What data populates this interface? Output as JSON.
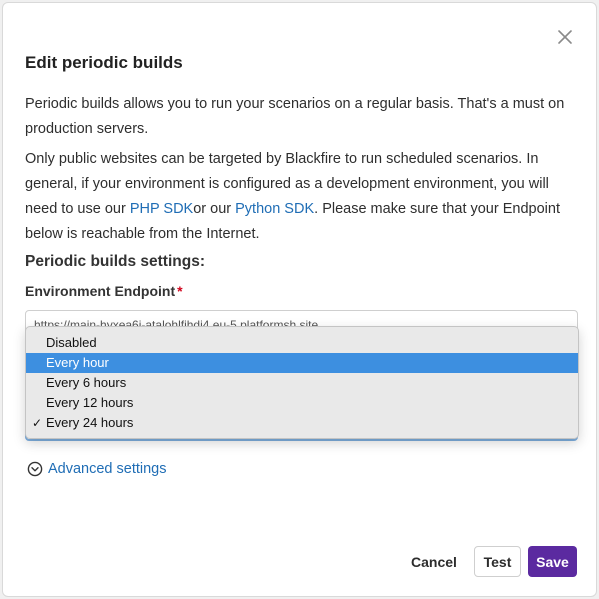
{
  "modal": {
    "title": "Edit periodic builds",
    "close_icon": "close-icon",
    "intro": "Periodic builds allows you to run your scenarios on a regular basis. That's a must on production servers.",
    "description": {
      "part1": "Only public websites can be targeted by Blackfire to run scheduled scenarios. In general, if your environment is configured as a development environment, you will need to use our ",
      "link_php": "PHP SDK",
      "part2": "or our ",
      "link_python": "Python SDK",
      "part3": ". Please make sure that your Endpoint below is reachable from the Internet."
    },
    "section_title": "Periodic builds settings:",
    "endpoint": {
      "label": "Environment Endpoint",
      "required_mark": "*",
      "value": "https://main-hyxea6i-atalohlfihdi4.eu-5.platformsh.site"
    },
    "frequency": {
      "options": [
        "Disabled",
        "Every hour",
        "Every 6 hours",
        "Every 12 hours",
        "Every 24 hours"
      ],
      "selected": "Every 24 hours",
      "highlighted": "Every hour",
      "check_mark": "✓"
    },
    "advanced": {
      "label": "Advanced settings",
      "icon": "chevron-circle-down-icon"
    },
    "buttons": {
      "cancel": "Cancel",
      "test": "Test",
      "save": "Save"
    }
  },
  "colors": {
    "link": "#1f6db5",
    "primary": "#5b2aa0",
    "highlight": "#3d8fe0",
    "required": "#d0021b"
  }
}
